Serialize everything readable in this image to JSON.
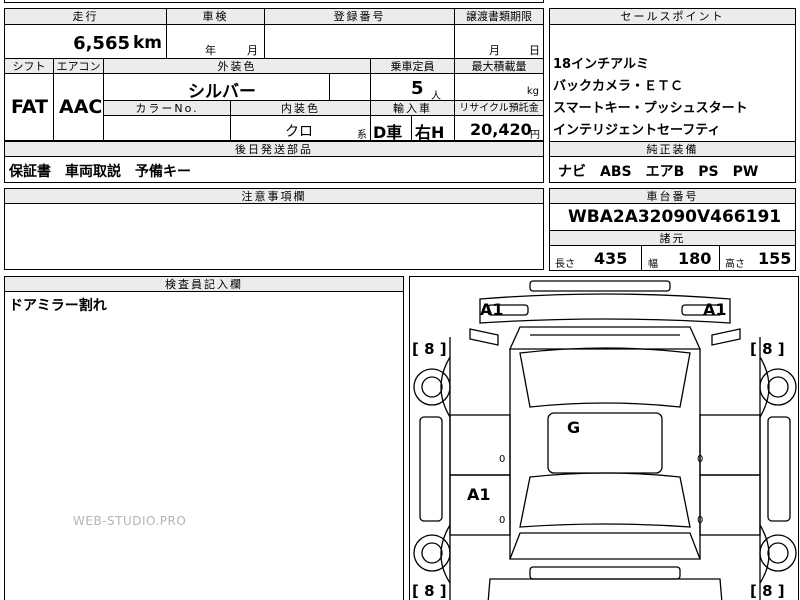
{
  "headers": {
    "mileage": "走行",
    "inspection": "車検",
    "registration": "登録番号",
    "transfer_deadline": "譲渡書類期限",
    "selling_points": "セールスポイント",
    "shift": "シフト",
    "aircon": "エアコン",
    "exterior_color": "外装色",
    "capacity": "乗車定員",
    "max_load": "最大積載量",
    "color_no": "カラーNo.",
    "interior_color": "内装色",
    "import": "輸入車",
    "recycle": "リサイクル預託金",
    "later_parts": "後日発送部品",
    "genuine_equipment": "純正装備",
    "notes": "注意事項欄",
    "chassis_no": "車台番号",
    "dimensions": "諸元",
    "inspector_notes": "検査員記入欄"
  },
  "values": {
    "mileage": "6,565",
    "mileage_unit": "km",
    "year_label": "年",
    "month_label": "月",
    "transfer_month": "月",
    "transfer_day": "日",
    "shift": "FAT",
    "aircon": "AAC",
    "exterior_color": "シルバー",
    "capacity": "5",
    "capacity_unit": "人",
    "load_unit": "kg",
    "interior_color": "クロ",
    "interior_suffix": "系",
    "import_d": "D車",
    "import_h": "右H",
    "recycle": "20,420",
    "recycle_unit": "円",
    "later_parts": "保証書　車両取説　予備キー",
    "genuine_equipment": "ナビ　ABS　エアB　PS　PW",
    "chassis_no": "WBA2A32090V466191",
    "length_label": "長さ",
    "length": "435",
    "width_label": "幅",
    "width": "180",
    "height_label": "高さ",
    "height": "155",
    "inspector_notes": "ドアミラー割れ"
  },
  "selling_points": [
    "18インチアルミ",
    "バックカメラ・ＥＴＣ",
    "スマートキー・プッシュスタート",
    "インテリジェントセーフティ"
  ],
  "diagram": {
    "mark_a1_left": "A1",
    "mark_a1_right": "A1",
    "mark_g": "G",
    "mark_a1_door": "A1",
    "tire_fl": "[ 8 ]",
    "tire_fr": "[ 8 ]",
    "tire_rl": "[ 8 ]",
    "tire_rr": "[ 8 ]",
    "zero_1": "0",
    "zero_2": "0",
    "zero_3": "0",
    "zero_4": "0"
  },
  "watermark": "WEB-STUDIO.PRO"
}
